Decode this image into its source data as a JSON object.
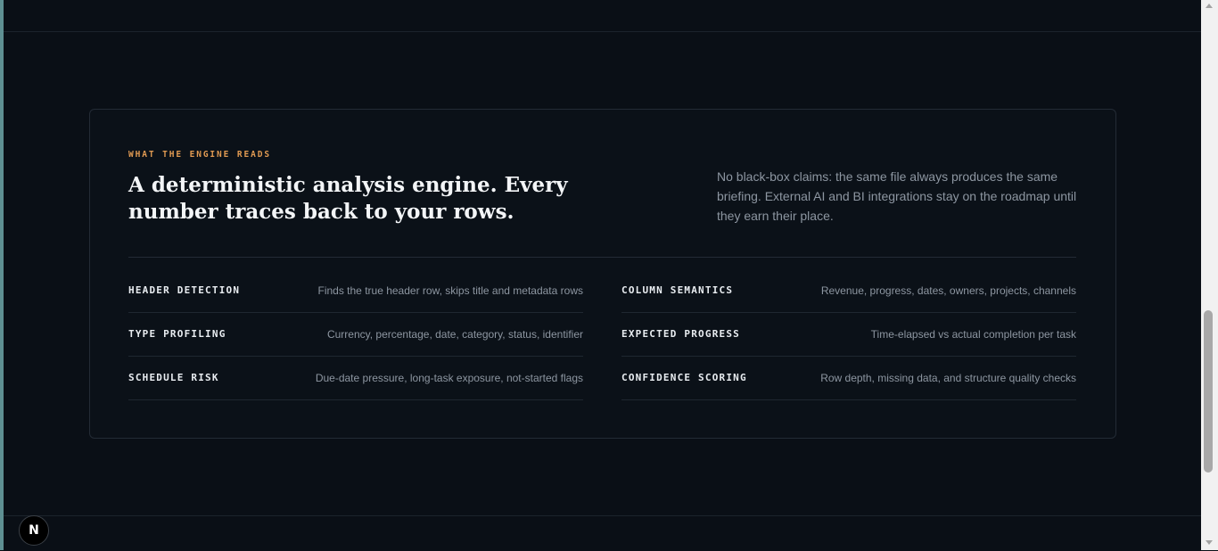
{
  "section": {
    "eyebrow": "WHAT THE ENGINE READS",
    "heading": "A deterministic analysis engine. Every number traces back to your rows.",
    "description": "No black-box claims: the same file always produces the same briefing. External AI and BI integrations stay on the roadmap until they earn their place."
  },
  "features": [
    {
      "name": "HEADER DETECTION",
      "desc": "Finds the true header row, skips title and metadata rows"
    },
    {
      "name": "COLUMN SEMANTICS",
      "desc": "Revenue, progress, dates, owners, projects, channels"
    },
    {
      "name": "TYPE PROFILING",
      "desc": "Currency, percentage, date, category, status, identifier"
    },
    {
      "name": "EXPECTED PROGRESS",
      "desc": "Time-elapsed vs actual completion per task"
    },
    {
      "name": "SCHEDULE RISK",
      "desc": "Due-date pressure, long-task exposure, not-started flags"
    },
    {
      "name": "CONFIDENCE SCORING",
      "desc": "Row depth, missing data, and structure quality checks"
    }
  ],
  "badge": {
    "letter": "N",
    "icon": "nextjs-logo-icon"
  },
  "colors": {
    "accent": "#e09a52",
    "background": "#0a0f16"
  }
}
